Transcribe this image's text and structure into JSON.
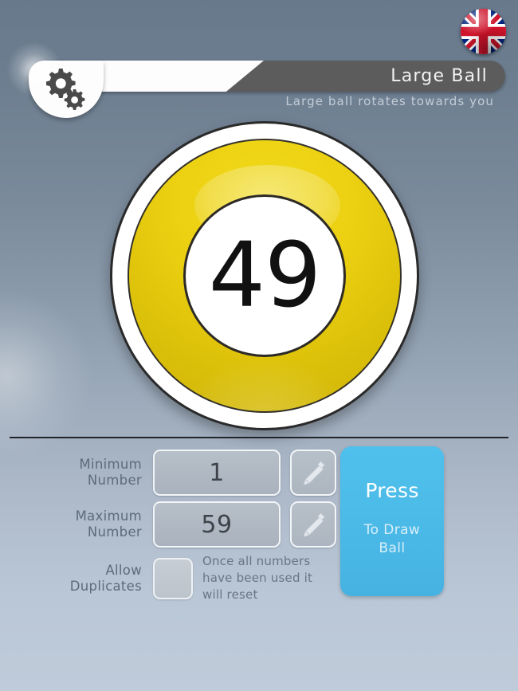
{
  "header": {
    "title": "Large  Ball",
    "subtitle": "Large  ball  rotates  towards  you",
    "settings_icon": "gears-icon",
    "language_icon": "uk-flag-icon"
  },
  "ball": {
    "number": "49",
    "color": "#ecd112",
    "inner_color": "#ffffff",
    "outline_color": "#2a2a2a"
  },
  "controls": {
    "minimum": {
      "label_line1": "Minimum",
      "label_line2": "Number",
      "value": "1",
      "edit_icon": "pencil-icon"
    },
    "maximum": {
      "label_line1": "Maximum",
      "label_line2": "Number",
      "value": "59",
      "edit_icon": "pencil-icon"
    },
    "duplicates": {
      "label_line1": "Allow",
      "label_line2": "Duplicates",
      "checked": false,
      "note_line1": "Once all numbers",
      "note_line2": "have been used it",
      "note_line3": "will reset"
    }
  },
  "draw_button": {
    "main_label": "Press",
    "sub_line1": "To Draw",
    "sub_line2": "Ball",
    "color": "#4cbbe8"
  },
  "theme": {
    "bg_top": "#68798c",
    "bg_bottom": "#bfcbd9",
    "header_bar": "#5c5c5c",
    "divider": "#21242a",
    "label_text": "#5e6b78"
  }
}
